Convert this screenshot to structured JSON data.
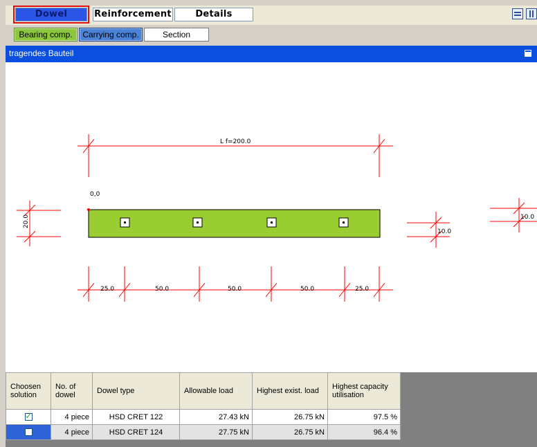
{
  "tabs": {
    "main": [
      "Dowel",
      "Reinforcement",
      "Details"
    ],
    "active": "Dowel",
    "sub": [
      "Bearing comp.",
      "Carrying comp.",
      "Section"
    ]
  },
  "panel": {
    "title": "tragendes Bauteil"
  },
  "drawing": {
    "length_label": "L f=200.0",
    "origin_label": "0,0",
    "height_label": "20.0",
    "right_label_1": "10.0",
    "right_label_2": "10.0",
    "spacing_labels": [
      "25.0",
      "50.0",
      "50.0",
      "50.0",
      "25.0"
    ],
    "fill_color": "#9acd32"
  },
  "table": {
    "headers": [
      "Choosen solution",
      "No. of dowel",
      "Dowel type",
      "Allowable load",
      "Highest exist. load",
      "Highest capacity utilisation"
    ],
    "rows": [
      {
        "chosen": true,
        "count": "4 piece",
        "type": "HSD CRET 122",
        "allowable": "27.43 kN",
        "existing": "26.75 kN",
        "utilisation": "97.5 %"
      },
      {
        "chosen": false,
        "count": "4 piece",
        "type": "HSD CRET 124",
        "allowable": "27.75 kN",
        "existing": "26.75 kN",
        "utilisation": "96.4 %"
      }
    ]
  }
}
